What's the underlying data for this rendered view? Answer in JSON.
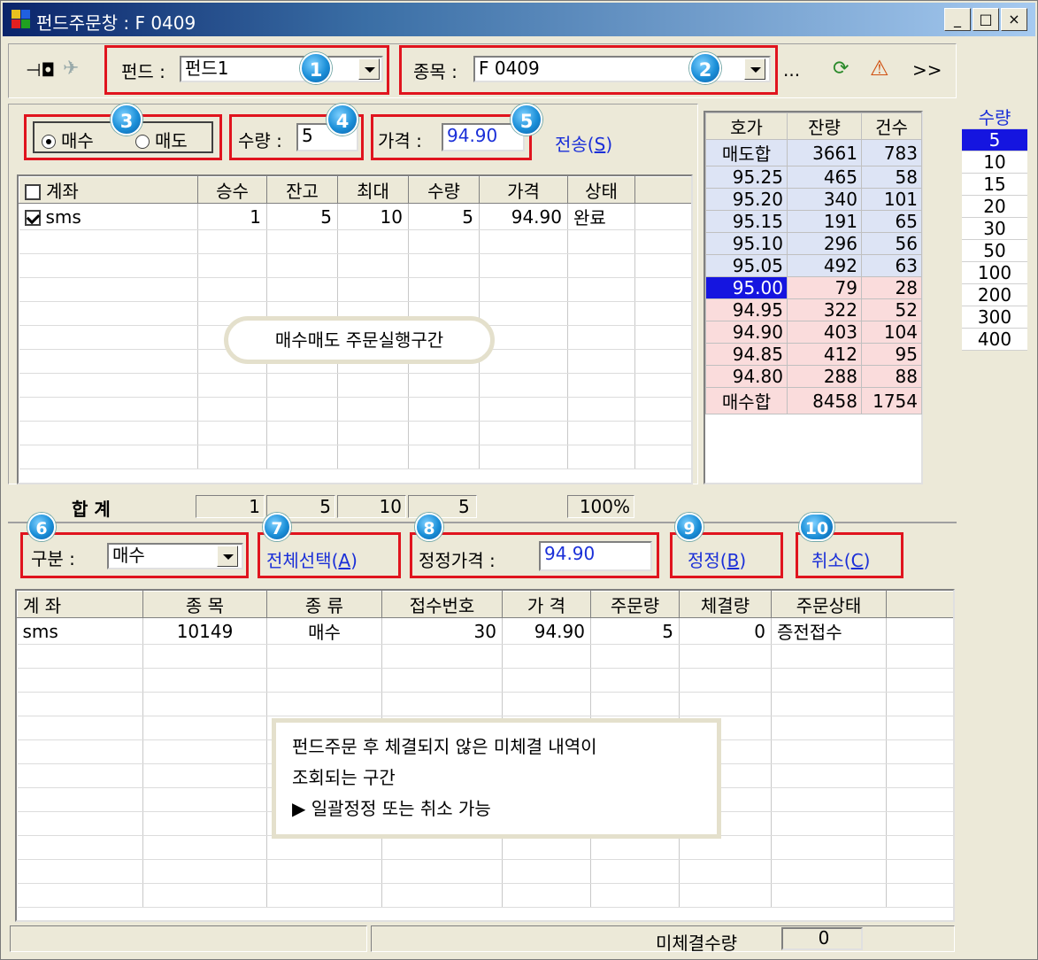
{
  "window": {
    "title": "펀드주문창 : F 0409",
    "min_label": "_",
    "max_label": "□",
    "close_label": "×"
  },
  "toolbar": {
    "fund_label": "펀드 :",
    "fund_value": "펀드1",
    "symbol_label": "종목 :",
    "symbol_value": "F 0409",
    "more_label": "...",
    "expand_label": ">>"
  },
  "order": {
    "buy_label": "매수",
    "sell_label": "매도",
    "qty_label": "수량 :",
    "qty_value": "5",
    "price_label": "가격 :",
    "price_value": "94.90",
    "send_label": "전송(",
    "send_key": "S",
    "send_end": ")"
  },
  "accounts_table": {
    "headers": [
      "계좌",
      "승수",
      "잔고",
      "최대",
      "수량",
      "가격",
      "상태"
    ],
    "rows": [
      {
        "account": "sms",
        "multiplier": "1",
        "balance": "5",
        "max": "10",
        "qty": "5",
        "price": "94.90",
        "status": "완료"
      }
    ],
    "sum_label": "합  계",
    "sums": [
      "1",
      "5",
      "10",
      "5",
      "100%"
    ],
    "bubble": "매수매도 주문실행구간"
  },
  "hoga": {
    "headers": [
      "호가",
      "잔량",
      "건수"
    ],
    "ask_total": {
      "label": "매도합",
      "qty": "3661",
      "count": "783"
    },
    "asks": [
      {
        "price": "95.25",
        "qty": "465",
        "count": "58"
      },
      {
        "price": "95.20",
        "qty": "340",
        "count": "101"
      },
      {
        "price": "95.15",
        "qty": "191",
        "count": "65"
      },
      {
        "price": "95.10",
        "qty": "296",
        "count": "56"
      },
      {
        "price": "95.05",
        "qty": "492",
        "count": "63"
      }
    ],
    "bids": [
      {
        "price": "95.00",
        "qty": "79",
        "count": "28"
      },
      {
        "price": "94.95",
        "qty": "322",
        "count": "52"
      },
      {
        "price": "94.90",
        "qty": "403",
        "count": "104"
      },
      {
        "price": "94.85",
        "qty": "412",
        "count": "95"
      },
      {
        "price": "94.80",
        "qty": "288",
        "count": "88"
      }
    ],
    "bid_total": {
      "label": "매수합",
      "qty": "8458",
      "count": "1754"
    }
  },
  "qty_panel": {
    "header": "수량",
    "items": [
      "5",
      "10",
      "15",
      "20",
      "30",
      "50",
      "100",
      "200",
      "300",
      "400"
    ]
  },
  "modify": {
    "type_label": "구분 :",
    "type_value": "매수",
    "select_all": "전체선택(",
    "select_all_key": "A",
    "select_all_end": ")",
    "price_label": "정정가격 :",
    "price_value": "94.90",
    "modify_label": "정정(",
    "modify_key": "B",
    "modify_end": ")",
    "cancel_label": "취소(",
    "cancel_key": "C",
    "cancel_end": ")"
  },
  "badges": [
    "1",
    "2",
    "3",
    "4",
    "5",
    "6",
    "7",
    "8",
    "9",
    "10"
  ],
  "pending_table": {
    "headers": [
      "계 좌",
      "종  목",
      "종  류",
      "접수번호",
      "가  격",
      "주문량",
      "체결량",
      "주문상태"
    ],
    "rows": [
      {
        "account": "sms",
        "symbol": "10149",
        "type": "매수",
        "receipt": "30",
        "price": "94.90",
        "qty": "5",
        "filled": "0",
        "status": "증전접수"
      }
    ],
    "note_line1": "펀드주문 후 체결되지 않은 미체결 내역이",
    "note_line2": "조회되는 구간",
    "note_line3": "▶ 일괄정정 또는 취소 가능"
  },
  "status": {
    "unfilled_label": "미체결수량",
    "unfilled_value": "0"
  },
  "colors": {
    "ask_bg": "#dde4f5",
    "bid_bg": "#fadcdc",
    "selected_bg": "#1515e0",
    "accent_red": "#e0141e",
    "badge_blue": "#1b8fd8"
  }
}
